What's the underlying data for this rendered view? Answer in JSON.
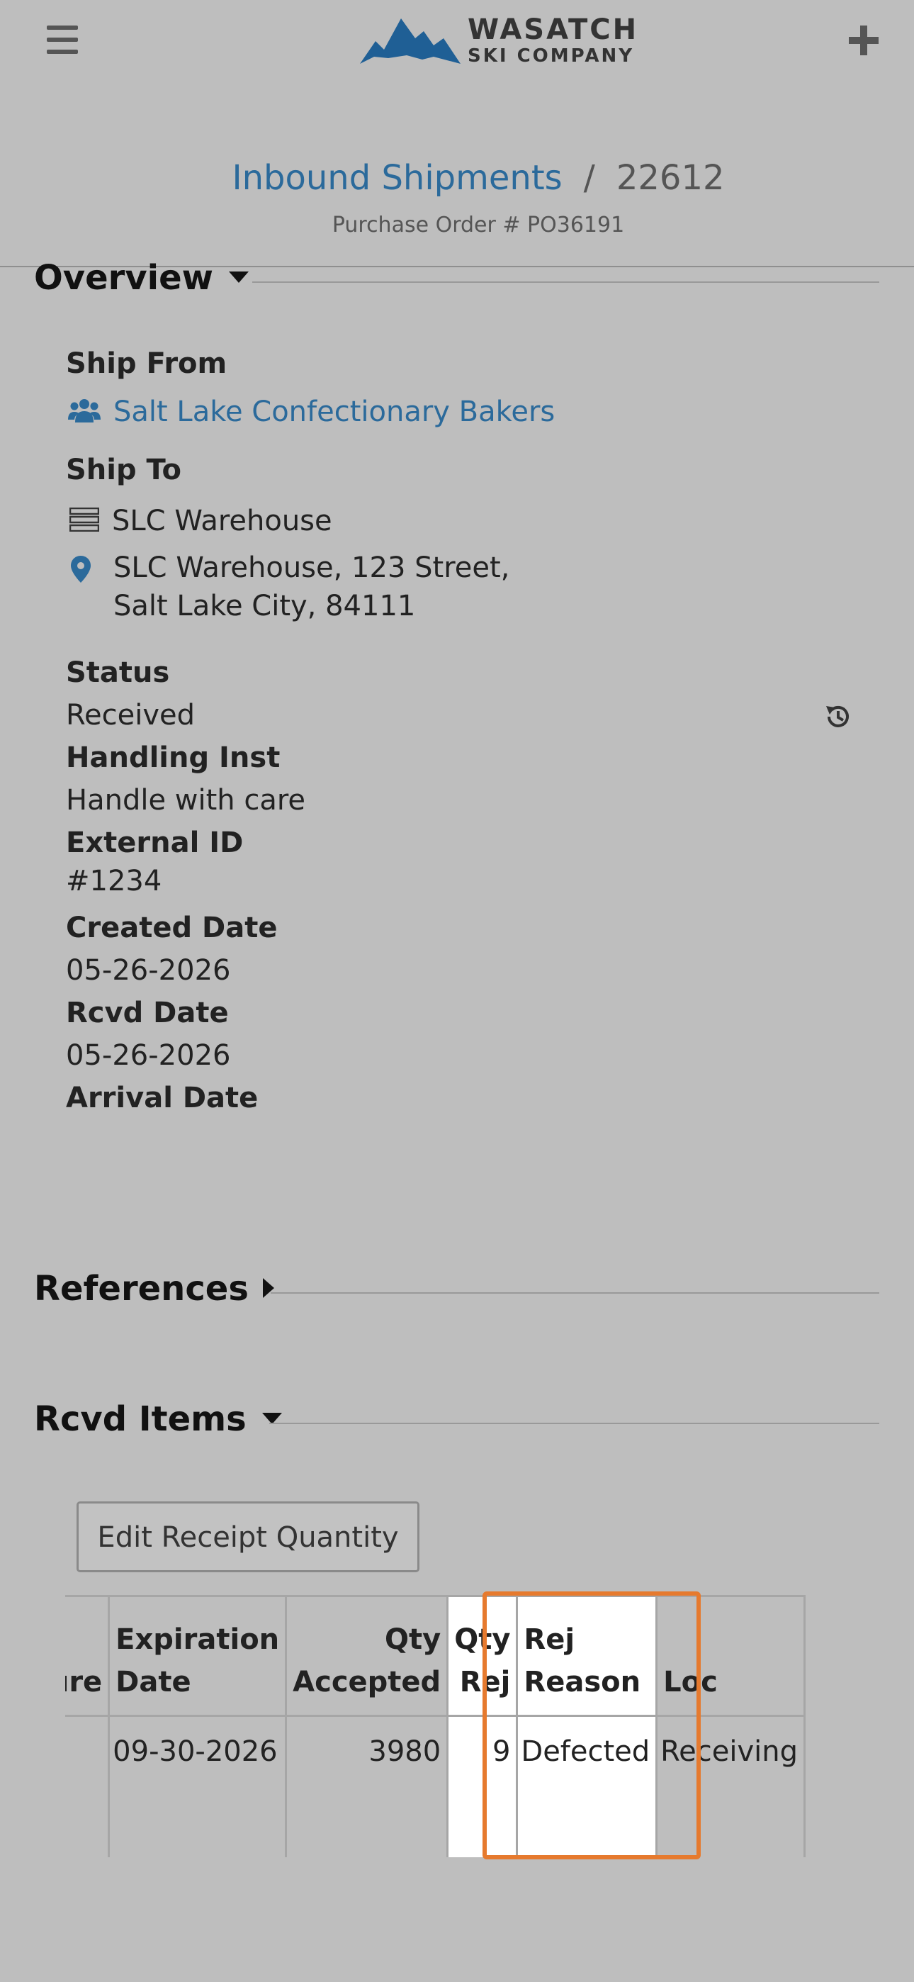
{
  "header": {
    "logo_line1": "WASATCH",
    "logo_line2": "SKI COMPANY"
  },
  "breadcrumb": {
    "parent": "Inbound Shipments",
    "separator": "/",
    "current": "22612"
  },
  "purchase_order": "Purchase Order # PO36191",
  "overview": {
    "title": "Overview",
    "ship_from_label": "Ship From",
    "ship_from_value": "Salt Lake Confectionary Bakers",
    "ship_to_label": "Ship To",
    "ship_to_warehouse": "SLC Warehouse",
    "ship_to_address_line1": "SLC Warehouse, 123 Street,",
    "ship_to_address_line2": "Salt Lake City, 84111",
    "status_label": "Status",
    "status_value": "Received",
    "handling_label": "Handling Inst",
    "handling_value": "Handle with care",
    "external_id_label": "External ID",
    "external_id_value": "#1234",
    "created_label": "Created Date",
    "created_value": "05-26-2026",
    "rcvd_label": "Rcvd Date",
    "rcvd_value": "05-26-2026",
    "arrival_label": "Arrival Date"
  },
  "references": {
    "title": "References"
  },
  "rcvd_items": {
    "title": "Rcvd Items",
    "edit_button": "Edit Receipt Quantity",
    "columns": {
      "temperature": "rature",
      "expiration_1": "Expiration",
      "expiration_2": "Date",
      "qty_acc_1": "Qty",
      "qty_acc_2": "Accepted",
      "qty_rej_1": "Qty",
      "qty_rej_2": "Rej",
      "rej_reason_1": "Rej",
      "rej_reason_2": "Reason",
      "loc": "Loc"
    },
    "rows": [
      {
        "temperature": "",
        "expiration": "09-30-2026",
        "qty_accepted": "3980",
        "qty_rej": "9",
        "rej_reason": "Defected",
        "loc": "Receiving"
      }
    ]
  },
  "colors": {
    "link": "#2b6a9b",
    "highlight": "#e67a2e",
    "background": "#bebebe",
    "logo_mountain": "#1f5f95"
  }
}
